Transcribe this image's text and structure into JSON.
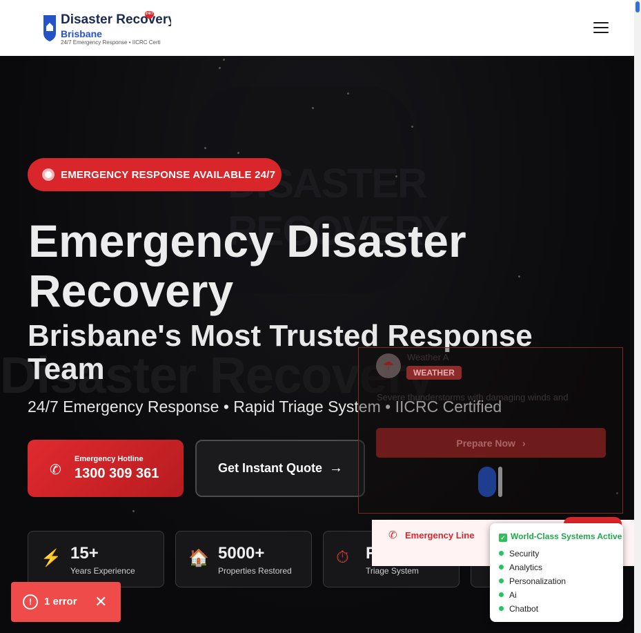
{
  "header": {
    "brand_name": "Disaster Recovery",
    "brand_city": "Brisbane",
    "brand_tagline": "24/7 Emergency Response • IICRC Certi",
    "brand_badge": "24/7",
    "menu_icon": "hamburger-menu-icon"
  },
  "hero": {
    "emergency_pill": "EMERGENCY RESPONSE AVAILABLE 24/7",
    "title": "Emergency Disaster Recovery",
    "subtitle": "Brisbane's Most Trusted Response Team",
    "tagline": "24/7 Emergency Response • Rapid Triage System • IICRC Certified",
    "background_logo_text": "DISASTER RECOVERY",
    "watermark_text": "Disaster Recovery",
    "hotline_label": "Emergency Hotline",
    "hotline_number": "1300 309 361",
    "quote_button": "Get Instant Quote",
    "stats": [
      {
        "value": "15+",
        "caption": "Years Experience",
        "icon": "lightning-icon"
      },
      {
        "value": "5000+",
        "caption": "Properties Restored",
        "icon": "house-icon"
      },
      {
        "value": "R",
        "caption": "Triage System",
        "icon": "stopwatch-icon"
      }
    ]
  },
  "weather_alert": {
    "title": "Weather A",
    "tag": "WEATHER",
    "message": "Severe thunderstorms with damaging winds and",
    "button": "Prepare Now"
  },
  "emergency_line": {
    "label": "Emergency Line"
  },
  "systems_panel": {
    "title": "World-Class Systems Active",
    "items": [
      "Security",
      "Analytics",
      "Personalization",
      "Ai",
      "Chatbot"
    ]
  },
  "error_toast": {
    "text": "1 error"
  },
  "colors": {
    "accent_red": "#d8262b",
    "brand_blue": "#2453c7",
    "status_green": "#22c55e",
    "error_red": "#ef4b4b"
  }
}
